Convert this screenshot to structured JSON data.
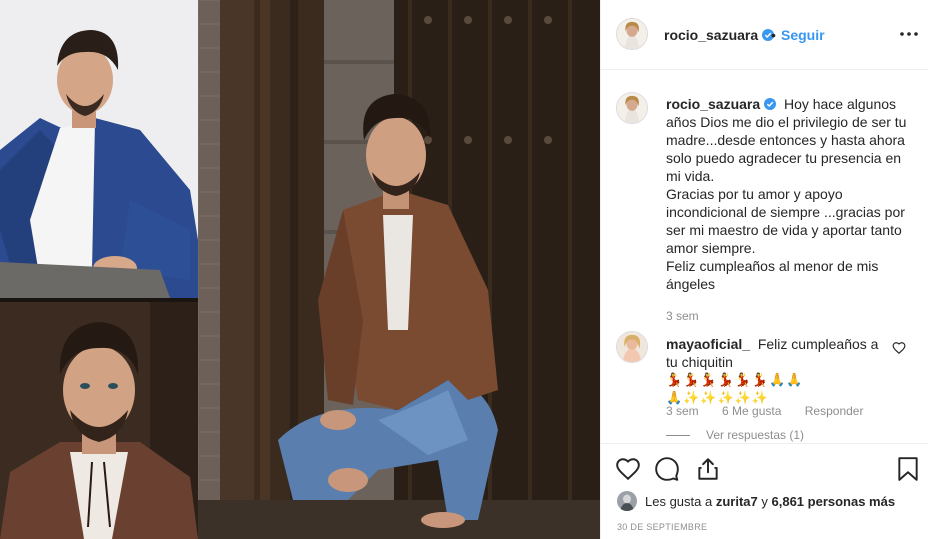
{
  "post": {
    "username": "rocio_sazuara",
    "follow_label": "Seguir",
    "separator": "•",
    "caption_lines": [
      "Hoy hace algunos",
      "años Dios me dio el privilegio de ser tu",
      "madre...desde entonces y hasta ahora",
      "solo puedo agradecer tu presencia en",
      "mi vida.",
      "Gracias por tu amor y apoyo",
      "incondicional de siempre ...gracias por",
      "ser mi maestro de vida y aportar tanto",
      "amor siempre.",
      "Feliz cumpleaños al menor de mis",
      "ángeles"
    ],
    "caption_time": "3 sem"
  },
  "comment": {
    "username": "mayaoficial_",
    "text_line1": "Feliz cumpleaños a",
    "text_line2": "tu chiquitin",
    "emoji_row1_a": "💃💃💃💃💃💃",
    "emoji_row1_b": "🙏🙏",
    "emoji_row2_a": "🙏",
    "emoji_row2_b": "✨✨✨✨✨",
    "time": "3 sem",
    "likes": "6 Me gusta",
    "reply_label": "Responder",
    "view_replies": "Ver respuestas (1)"
  },
  "likes": {
    "prefix": "Les gusta a",
    "user": "zurita7",
    "connector": "y",
    "count": "6,861 personas más"
  },
  "date": "30 de septiembre",
  "icons": {
    "verified": "verified-badge-icon",
    "more": "more-options-icon",
    "like": "heart-icon",
    "comment": "comment-bubble-icon",
    "share": "share-icon",
    "save": "bookmark-icon"
  },
  "colors": {
    "link_blue": "#3897f0",
    "text_dark": "#262626",
    "text_muted": "#8e8e8e",
    "border": "#efefef"
  }
}
